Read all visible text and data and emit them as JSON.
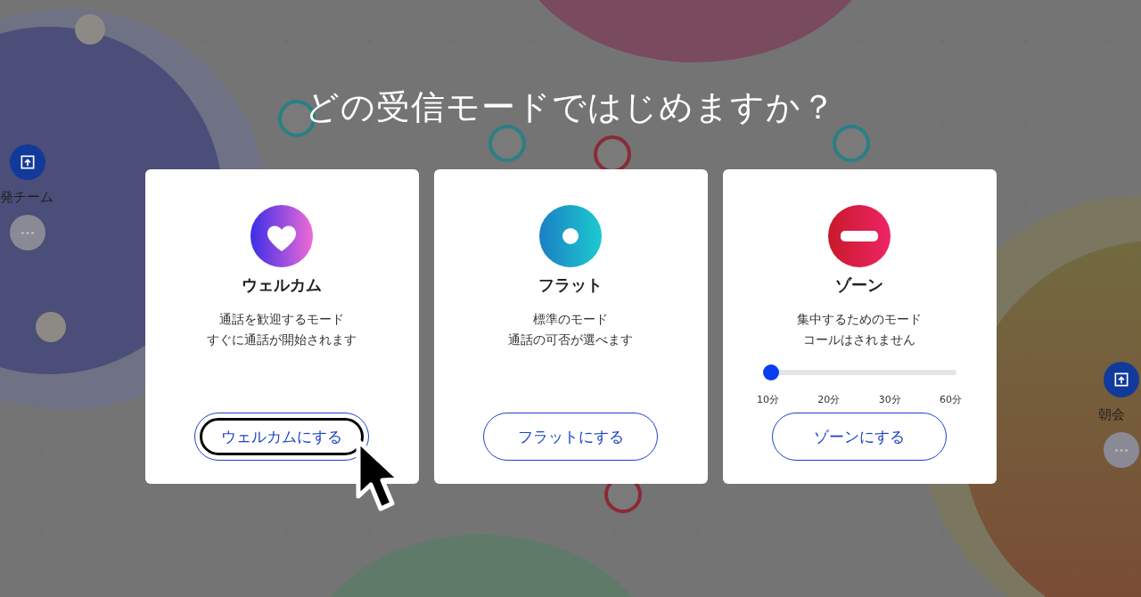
{
  "title": "どの受信モードではじめますか？",
  "background": {
    "rooms": [
      {
        "name": "発チーム"
      },
      {
        "name": "朝会"
      }
    ]
  },
  "modes": [
    {
      "kind": "welcome",
      "name": "ウェルカム",
      "description": [
        "通話を歓迎するモード",
        "すぐに通話が開始されます"
      ],
      "button": "ウェルカムにする",
      "focused": true
    },
    {
      "kind": "flat",
      "name": "フラット",
      "description": [
        "標準のモード",
        "通話の可否が選べます"
      ],
      "button": "フラットにする",
      "focused": false
    },
    {
      "kind": "zone",
      "name": "ゾーン",
      "description": [
        "集中するためのモード",
        "コールはされません"
      ],
      "slider": {
        "level": 0,
        "ticks": [
          "10分",
          "20分",
          "30分",
          "60分"
        ]
      },
      "button": "ゾーンにする",
      "focused": false
    }
  ]
}
